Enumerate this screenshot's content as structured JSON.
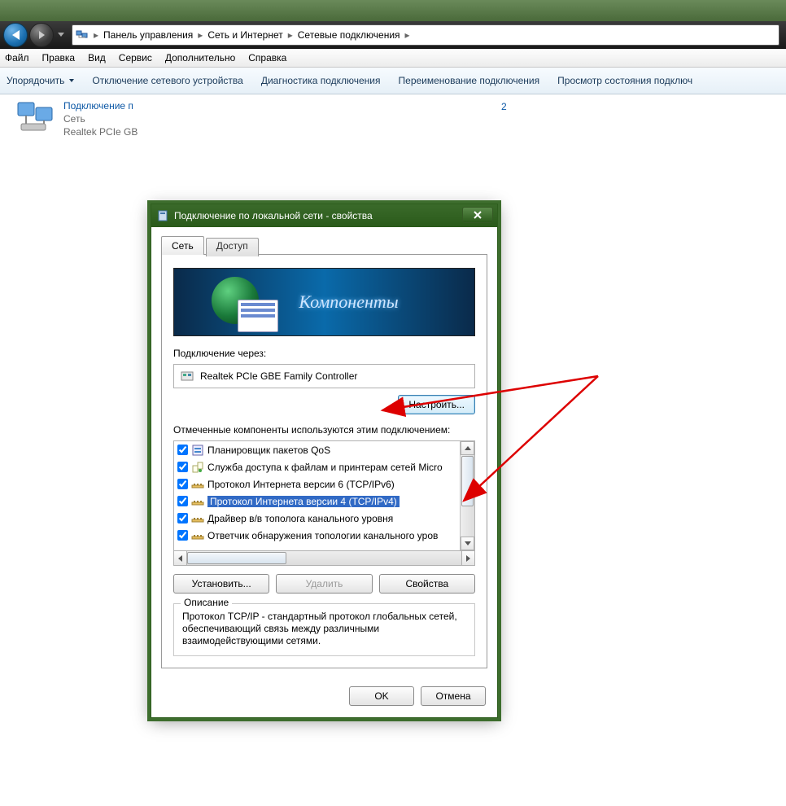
{
  "breadcrumb": {
    "items": [
      "Панель управления",
      "Сеть и Интернет",
      "Сетевые подключения"
    ]
  },
  "menubar": [
    "Файл",
    "Правка",
    "Вид",
    "Сервис",
    "Дополнительно",
    "Справка"
  ],
  "toolbar": {
    "organize": "Упорядочить",
    "disable": "Отключение сетевого устройства",
    "diagnose": "Диагностика подключения",
    "rename": "Переименование подключения",
    "status": "Просмотр состояния подключ"
  },
  "connection_item": {
    "title": "Подключение п",
    "network": "Сеть",
    "adapter": "Realtek PCIe GB"
  },
  "connection_item_2_suffix": " 2",
  "dialog": {
    "title": "Подключение по локальной сети - свойства",
    "tabs": {
      "network": "Сеть",
      "access": "Доступ"
    },
    "banner_text": "Компоненты",
    "connect_using_label": "Подключение через:",
    "adapter": "Realtek PCIe GBE Family Controller",
    "configure_btn": "Настроить...",
    "components_label": "Отмеченные компоненты используются этим подключением:",
    "components": [
      {
        "checked": true,
        "icon": "qos",
        "name": "Планировщик пакетов QoS"
      },
      {
        "checked": true,
        "icon": "share",
        "name": "Служба доступа к файлам и принтерам сетей Micro"
      },
      {
        "checked": true,
        "icon": "proto",
        "name": "Протокол Интернета версии 6 (TCP/IPv6)"
      },
      {
        "checked": true,
        "icon": "proto",
        "name": "Протокол Интернета версии 4 (TCP/IPv4)",
        "selected": true
      },
      {
        "checked": true,
        "icon": "proto",
        "name": "Драйвер в/в тополога канального уровня"
      },
      {
        "checked": true,
        "icon": "proto",
        "name": "Ответчик обнаружения топологии канального уров"
      }
    ],
    "install_btn": "Установить...",
    "uninstall_btn": "Удалить",
    "properties_btn": "Свойства",
    "desc_legend": "Описание",
    "desc_text": "Протокол TCP/IP - стандартный протокол глобальных сетей, обеспечивающий связь между различными взаимодействующими сетями.",
    "ok_btn": "OK",
    "cancel_btn": "Отмена"
  }
}
